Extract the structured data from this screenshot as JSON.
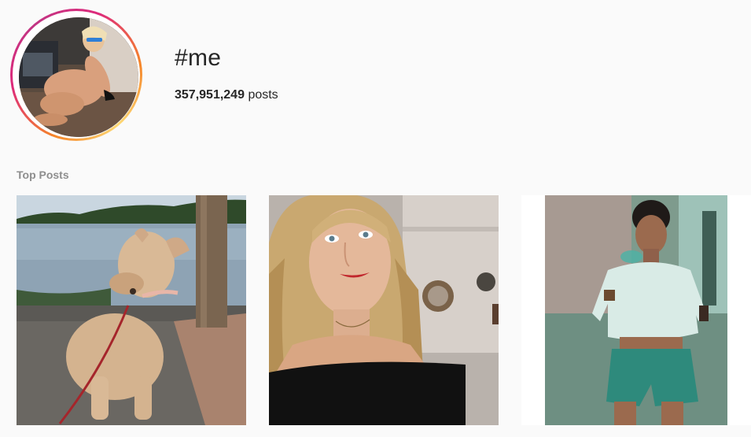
{
  "hashtag": {
    "title": "#me",
    "post_count": "357,951,249",
    "post_count_suffix": "posts"
  },
  "sections": {
    "top_posts_label": "Top Posts"
  },
  "colors": {
    "background": "#fafafa",
    "text_primary": "#262626",
    "text_secondary": "#8e8e8e",
    "story_ring": [
      "#f58529",
      "#dd2a7b",
      "#c13584"
    ]
  },
  "top_posts": [
    {
      "subject": "dog-on-lakeside-pier"
    },
    {
      "subject": "blonde-woman-selfie"
    },
    {
      "subject": "woman-in-denim-shorts"
    }
  ]
}
